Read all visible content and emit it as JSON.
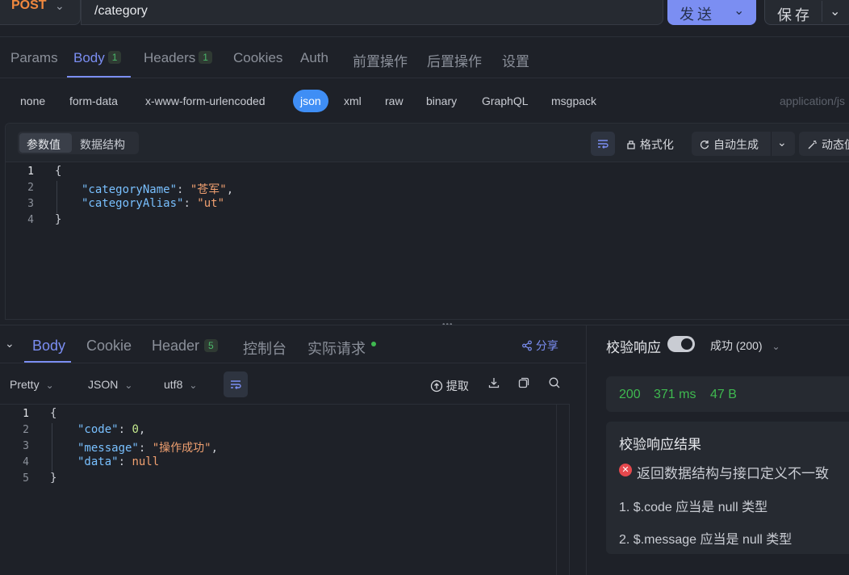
{
  "request": {
    "method": "POST",
    "url": "/category",
    "send_label": "发送",
    "save_label": "保存"
  },
  "request_tabs": [
    {
      "label": "Params"
    },
    {
      "label": "Body",
      "badge": "1"
    },
    {
      "label": "Headers",
      "badge": "1"
    },
    {
      "label": "Cookies"
    },
    {
      "label": "Auth"
    },
    {
      "label": "前置操作"
    },
    {
      "label": "后置操作"
    },
    {
      "label": "设置"
    }
  ],
  "body_types": [
    "none",
    "form-data",
    "x-www-form-urlencoded",
    "json",
    "xml",
    "raw",
    "binary",
    "GraphQL",
    "msgpack"
  ],
  "content_type": "application/js",
  "editor": {
    "seg_values": "参数值",
    "seg_schema": "数据结构",
    "format_label": "格式化",
    "auto_label": "自动生成",
    "dynamic_label": "动态值",
    "line_numbers": [
      "1",
      "2",
      "3",
      "4"
    ],
    "lines": {
      "l1": "{",
      "l2_key": "\"categoryName\"",
      "l2_colon": ": ",
      "l2_val": "\"苍军\"",
      "l2_comma": ",",
      "l3_key": "\"categoryAlias\"",
      "l3_colon": ": ",
      "l3_val": "\"ut\"",
      "l4": "}"
    }
  },
  "response": {
    "tabs": [
      {
        "label": "Body"
      },
      {
        "label": "Cookie"
      },
      {
        "label": "Header",
        "badge": "5"
      },
      {
        "label": "控制台"
      },
      {
        "label": "实际请求"
      }
    ],
    "share_label": "分享",
    "view_mode": "Pretty",
    "format": "JSON",
    "encoding": "utf8",
    "extract_label": "提取",
    "line_numbers": [
      "1",
      "2",
      "3",
      "4",
      "5"
    ],
    "lines": {
      "l1": "{",
      "l2_key": "\"code\"",
      "l2_colon": ": ",
      "l2_val": "0",
      "l2_comma": ",",
      "l3_key": "\"message\"",
      "l3_colon": ": ",
      "l3_val": "\"操作成功\"",
      "l3_comma": ",",
      "l4_key": "\"data\"",
      "l4_colon": ": ",
      "l4_val": "null",
      "l5": "}"
    }
  },
  "validation": {
    "label": "校验响应",
    "toggle_on": true,
    "status_select": "成功 (200)",
    "status_code": "200",
    "time": "371 ms",
    "size": "47 B",
    "result_title": "校验响应结果",
    "error_summary": "返回数据结构与接口定义不一致",
    "errors": [
      "1. $.code 应当是 null 类型",
      "2. $.message 应当是 null 类型"
    ]
  },
  "colors": {
    "accent": "#7b8ef2",
    "method": "#f0883e",
    "success": "#3fb950",
    "error": "#e5484d",
    "json_active": "#3f8ef5"
  }
}
